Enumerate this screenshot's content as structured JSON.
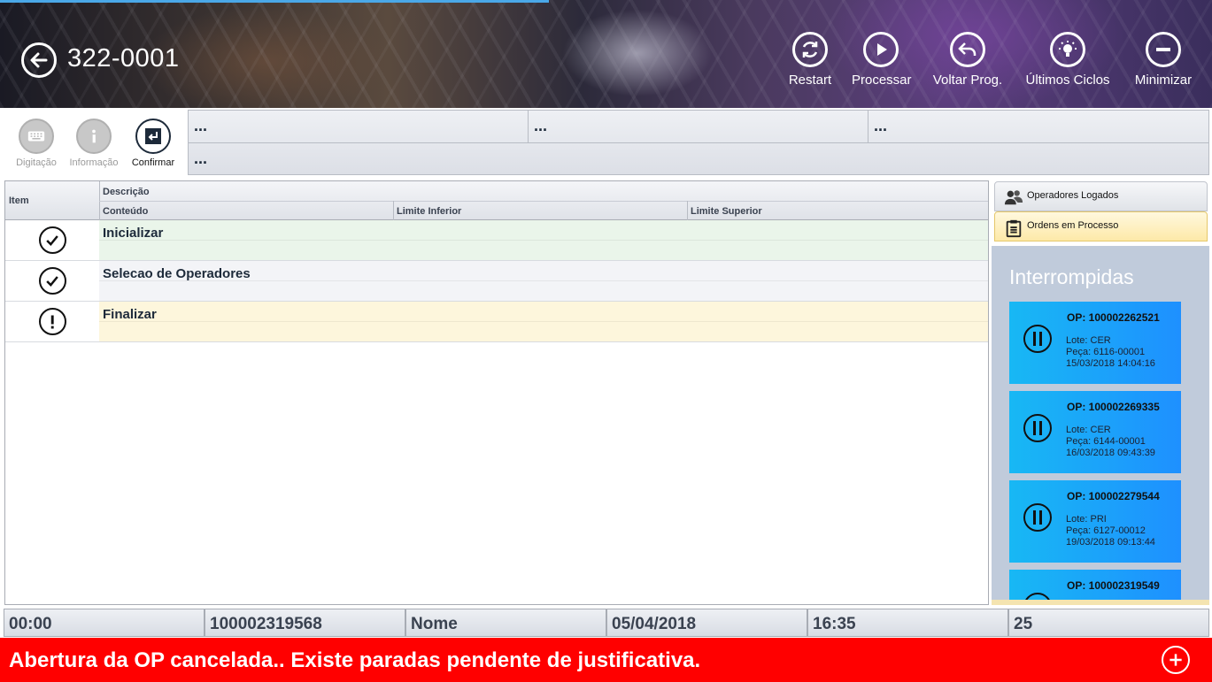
{
  "header": {
    "title": "322-0001",
    "buttons": [
      {
        "label": "Restart",
        "icon": "refresh-icon"
      },
      {
        "label": "Processar",
        "icon": "play-icon"
      },
      {
        "label": "Voltar Prog.",
        "icon": "undo-icon"
      },
      {
        "label": "Últimos Ciclos",
        "icon": "lightbulb-icon"
      },
      {
        "label": "Minimizar",
        "icon": "minus-icon"
      }
    ]
  },
  "toolbar": {
    "buttons": [
      {
        "label": "Digitação",
        "icon": "keyboard-icon",
        "state": "disabled"
      },
      {
        "label": "Informação",
        "icon": "info-icon",
        "state": "disabled"
      },
      {
        "label": "Confirmar",
        "icon": "enter-icon",
        "state": "active"
      }
    ],
    "info_cells": [
      "...",
      "...",
      "...",
      "..."
    ]
  },
  "grid": {
    "headers": {
      "item": "Item",
      "descricao": "Descrição",
      "conteudo": "Conteúdo",
      "limite_inferior": "Limite Inferior",
      "limite_superior": "Limite Superior"
    },
    "rows": [
      {
        "title": "Inicializar",
        "status": "done",
        "icon": "check-circle-icon",
        "bg": "#eaf5ea"
      },
      {
        "title": "Selecao de Operadores",
        "status": "done",
        "icon": "check-circle-icon",
        "bg": "#f3f4f7"
      },
      {
        "title": "Finalizar",
        "status": "pending",
        "icon": "exclamation-circle-icon",
        "bg": "#fdf6dc"
      }
    ]
  },
  "side": {
    "tabs": [
      {
        "label": "Operadores Logados",
        "icon": "users-icon"
      },
      {
        "label": "Ordens em Processo",
        "icon": "clipboard-icon"
      }
    ],
    "section_title": "Interrompidas",
    "orders": [
      {
        "op": "OP: 100002262521",
        "lote": "Lote: CER",
        "peca": "Peça: 6116-00001",
        "data": "15/03/2018 14:04:16"
      },
      {
        "op": "OP: 100002269335",
        "lote": "Lote: CER",
        "peca": "Peça: 6144-00001",
        "data": "16/03/2018 09:43:39"
      },
      {
        "op": "OP: 100002279544",
        "lote": "Lote: PRI",
        "peca": "Peça: 6127-00012",
        "data": "19/03/2018 09:13:44"
      },
      {
        "op": "OP: 100002319549",
        "lote": "",
        "peca": "",
        "data": ""
      }
    ]
  },
  "status_bar": [
    "00:00",
    "100002319568",
    "Nome",
    "05/04/2018",
    "16:35",
    "25"
  ],
  "error": {
    "message": "Abertura da OP cancelada.. Existe paradas pendente de justificativa.",
    "color": "#ff0000"
  }
}
